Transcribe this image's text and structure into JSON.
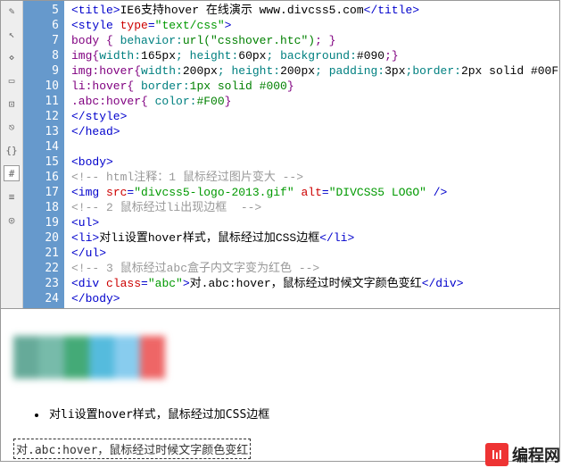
{
  "toolbar_icons": [
    "pencil",
    "cursor",
    "tag",
    "rect",
    "dashed",
    "link",
    "sep",
    "braces",
    "sep",
    "hash",
    "bars",
    "target"
  ],
  "lines": {
    "start": 5,
    "count": 20
  },
  "code": [
    {
      "type": "title",
      "open": "<title>",
      "text": "IE6支持hover 在线演示 www.divcss5.com",
      "close": "</title>"
    },
    {
      "type": "style_open",
      "open": "<style ",
      "attr": "type",
      "eq": "=",
      "val": "\"text/css\"",
      "close": ">"
    },
    {
      "type": "css",
      "sel": "body ",
      "brace": "{ ",
      "prop": "behavior:",
      "val": "url(\"csshover.htc\")",
      "end": "; }"
    },
    {
      "type": "css",
      "sel": "img",
      "brace": "{",
      "prop1": "width:",
      "v1": "165px",
      "prop2": "height:",
      "v2": "60px",
      "prop3": "background:",
      "v3": "#090",
      "end": ";}"
    },
    {
      "type": "css",
      "sel": "img:hover",
      "brace": "{",
      "prop1": "width:",
      "v1": "200px",
      "prop2": "height:",
      "v2": "200px",
      "prop3": "padding:",
      "v3": "3px",
      "prop4": "border:",
      "v4": "2px solid #00F",
      "end": ""
    },
    {
      "type": "css",
      "sel": "li:hover",
      "brace": "{ ",
      "prop": "border:",
      "val": "1px solid #000",
      "end": "}"
    },
    {
      "type": "css",
      "sel": ".abc:hover",
      "brace": "{ ",
      "prop": "color:",
      "val": "#F00",
      "end": "}"
    },
    {
      "type": "close",
      "tag": "</style>"
    },
    {
      "type": "close",
      "tag": "</head>"
    },
    {
      "type": "blank",
      "text": ""
    },
    {
      "type": "open",
      "tag": "<body>"
    },
    {
      "type": "comment",
      "text": "<!-- html注释：1 鼠标经过图片变大 -->"
    },
    {
      "type": "img",
      "open": "<img ",
      "a1": "src",
      "v1": "\"divcss5-logo-2013.gif\"",
      "a2": "alt",
      "v2": "\"DIVCSS5 LOGO\"",
      "close": " />"
    },
    {
      "type": "comment",
      "text": "<!-- 2 鼠标经过li出现边框  -->"
    },
    {
      "type": "open",
      "tag": "<ul>"
    },
    {
      "type": "li",
      "open": "<li>",
      "text": "对li设置hover样式，鼠标经过加CSS边框",
      "close": "</li>"
    },
    {
      "type": "close",
      "tag": "</ul>"
    },
    {
      "type": "comment",
      "text": "<!-- 3 鼠标经过abc盒子内文字变为红色 -->"
    },
    {
      "type": "div",
      "open": "<div ",
      "attr": "class",
      "eq": "=",
      "val": "\"abc\"",
      "mid": ">",
      "text": "对.abc:hover，鼠标经过时候文字颜色变红",
      "close": "</div>"
    },
    {
      "type": "close",
      "tag": "</body>"
    }
  ],
  "preview": {
    "li_text": "对li设置hover样式，鼠标经过加CSS边框",
    "abc_text": "对.abc:hover，鼠标经过时候文字颜色变红"
  },
  "watermark": {
    "logo": "lıl",
    "text": "编程网"
  }
}
